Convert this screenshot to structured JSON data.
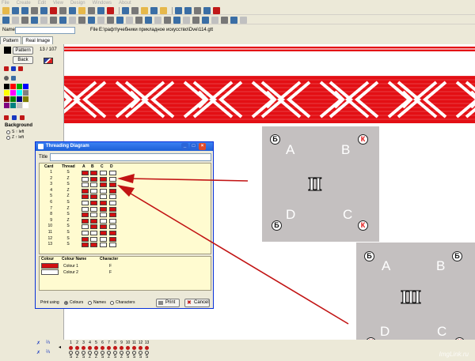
{
  "menu": [
    "File",
    "Create",
    "Edit",
    "View",
    "Design",
    "Windows",
    "About"
  ],
  "name_label": "Name",
  "file_label": "File",
  "file_path": "E:\\рафт\\учебники прикладное искусство\\Dve\\114.gtt",
  "tabs": [
    {
      "label": "Pattern"
    },
    {
      "label": "Real Image"
    }
  ],
  "left": {
    "pattern_btn": "Pattern",
    "back_btn": "Back",
    "counter": "13 / 107",
    "background_title": "Background",
    "radio1": "S ↑ left",
    "radio2": "Z ↑ left"
  },
  "palette": [
    "#000000",
    "#ff0000",
    "#00aa00",
    "#0000ff",
    "#ffff00",
    "#ff00ff",
    "#00ffff",
    "#808080",
    "#800000",
    "#008000",
    "#000080",
    "#808000",
    "#800080",
    "#008080",
    "#c0c0c0",
    "#ffffff"
  ],
  "dialog": {
    "title": "Threading Diagram",
    "title_label": "Title",
    "headers": {
      "card": "Card",
      "thread": "Thread",
      "a": "A",
      "b": "B",
      "c": "C",
      "d": "D"
    },
    "rows": [
      {
        "card": "1",
        "thread": "S"
      },
      {
        "card": "2",
        "thread": "Z"
      },
      {
        "card": "3",
        "thread": "S"
      },
      {
        "card": "4",
        "thread": "Z"
      },
      {
        "card": "5",
        "thread": "Z"
      },
      {
        "card": "6",
        "thread": "S"
      },
      {
        "card": "7",
        "thread": "Z"
      },
      {
        "card": "8",
        "thread": "S"
      },
      {
        "card": "9",
        "thread": "Z"
      },
      {
        "card": "10",
        "thread": "S"
      },
      {
        "card": "11",
        "thread": "S"
      },
      {
        "card": "12",
        "thread": "S"
      },
      {
        "card": "13",
        "thread": "S"
      }
    ],
    "colour_headers": {
      "colour": "Colour",
      "name": "Colour Name",
      "character": "Character"
    },
    "colours": [
      {
        "name": "Colour 1",
        "char": "F",
        "hex": "#d11010"
      },
      {
        "name": "Colour 2",
        "char": "F",
        "hex": "#ffffff"
      }
    ],
    "print_using": "Print using",
    "opt_colours": "Colours",
    "opt_names": "Names",
    "opt_characters": "Characters",
    "print_btn": "Print",
    "cancel_btn": "Cancel"
  },
  "card2": {
    "roman": "II",
    "a": "A",
    "b": "B",
    "c": "C",
    "d": "D"
  },
  "card3": {
    "roman": "III",
    "a": "A",
    "b": "B",
    "c": "C",
    "d": "D"
  },
  "card_glyph_b": "Б",
  "card_glyph_k": "К",
  "bottom": {
    "numbers": [
      "1",
      "2",
      "3",
      "4",
      "5",
      "6",
      "7",
      "8",
      "9",
      "10",
      "11",
      "12",
      "13"
    ],
    "letters": [
      "S",
      "Z",
      "S",
      "Z",
      "Z",
      "S",
      "Z",
      "S",
      "Z",
      "S",
      "S",
      "S",
      "S"
    ]
  },
  "watermark": "ImgLink.ru",
  "colors": {
    "accent_red": "#e30f14",
    "arrow_red": "#c21414"
  }
}
